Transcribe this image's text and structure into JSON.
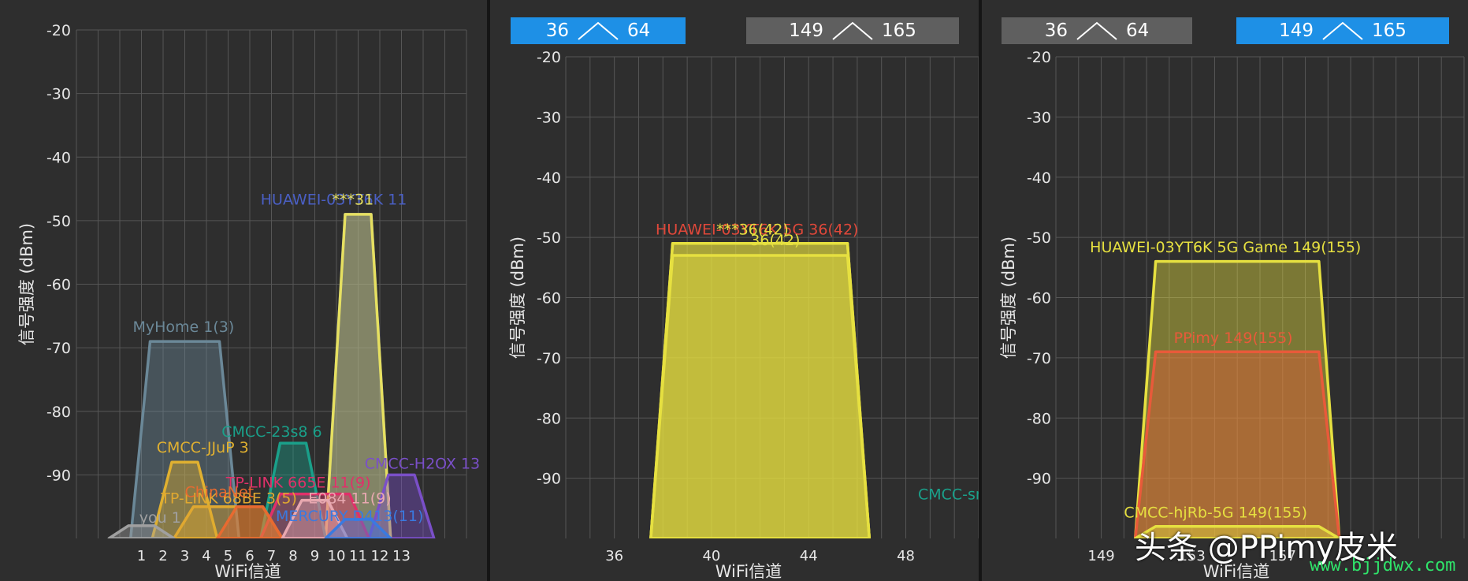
{
  "tabs_panel2": [
    {
      "left_num": "36",
      "right_num": "64",
      "active": true
    },
    {
      "left_num": "149",
      "right_num": "165",
      "active": false
    }
  ],
  "tabs_panel3": [
    {
      "left_num": "36",
      "right_num": "64",
      "active": false
    },
    {
      "left_num": "149",
      "right_num": "165",
      "active": true
    }
  ],
  "watermark": {
    "main": "头条 @PPimy皮米",
    "url": "www.bjjdwx.com"
  },
  "chart_data": [
    {
      "type": "area",
      "ylabel": "信号强度 (dBm)",
      "xlabel": "WiFi信道",
      "ylim": [
        -100,
        -20
      ],
      "xlim": [
        -2,
        16
      ],
      "yticks": [
        -20,
        -30,
        -40,
        -50,
        -60,
        -70,
        -80,
        -90
      ],
      "xticks": [
        1,
        2,
        3,
        4,
        5,
        6,
        7,
        8,
        9,
        10,
        11,
        12,
        13
      ],
      "grid": true,
      "networks": [
        {
          "name": "MyHome 1(3)",
          "channel": 3,
          "width": 3,
          "rssi": -69,
          "color": "#6b8898",
          "label_x": 0.6,
          "label_y": -67.5
        },
        {
          "name": "HUAWEI-03YT6K 11",
          "channel": 11,
          "width": 1,
          "rssi": -49,
          "color": "#4a5fc4",
          "label_x": 6.5,
          "label_y": -47.5
        },
        {
          "name": "***31",
          "channel": 11,
          "width": 1,
          "rssi": -49,
          "color": "#e6e060",
          "label_x": 9.8,
          "label_y": -47.5
        },
        {
          "name": "CMCC-23s8 6",
          "channel": 8,
          "width": 1,
          "rssi": -85,
          "color": "#1aa08a",
          "label_x": 4.7,
          "label_y": -84
        },
        {
          "name": "CMCC-JJuP 3",
          "channel": 3,
          "width": 1,
          "rssi": -88,
          "color": "#e0b030",
          "label_x": 1.7,
          "label_y": -86.5
        },
        {
          "name": "CMCC-H2OX 13",
          "channel": 13,
          "width": 1,
          "rssi": -90,
          "color": "#7a4fc8",
          "label_x": 11.3,
          "label_y": -89
        },
        {
          "name": "TP-LINK 665E 11(9)",
          "channel": 9,
          "width": 3,
          "rssi": -93,
          "color": "#e0306a",
          "label_x": 4.9,
          "label_y": -92
        },
        {
          "name": "TP-LINK 68BE 3(5)",
          "channel": 5,
          "width": 3,
          "rssi": -95,
          "color": "#e0a830",
          "label_x": 1.9,
          "label_y": -94.5
        },
        {
          "name": "ChinaNet",
          "channel": 6,
          "width": 1,
          "rssi": -95,
          "color": "#e86a30",
          "label_x": 3.0,
          "label_y": -93.5
        },
        {
          "name": "E084 11(9)",
          "channel": 9,
          "width": 1,
          "rssi": -94,
          "color": "#e8a8b0",
          "label_x": 8.7,
          "label_y": -94.5
        },
        {
          "name": "MERCURY D413(11)",
          "channel": 11,
          "width": 1,
          "rssi": -97,
          "color": "#3a7ae0",
          "label_x": 7.2,
          "label_y": -97.3
        },
        {
          "name": "you 1",
          "channel": 1,
          "width": 1,
          "rssi": -98,
          "color": "#a0a0a0",
          "label_x": 0.9,
          "label_y": -97.5
        }
      ]
    },
    {
      "type": "area",
      "ylabel": "信号强度 (dBm)",
      "xlabel": "WiFi信道",
      "ylim": [
        -100,
        -20
      ],
      "xlim": [
        34,
        51
      ],
      "yticks": [
        -20,
        -30,
        -40,
        -50,
        -60,
        -70,
        -80,
        -90
      ],
      "xticks": [
        36,
        40,
        44,
        48
      ],
      "grid": true,
      "networks": [
        {
          "name": "HUAWEI-03YT6K 5G 36(42)",
          "channel": 42,
          "width": 7,
          "rssi": -51,
          "color": "#e6e040",
          "label_x": 37.7,
          "label_y": -49.5,
          "label_color": "#e0483a"
        },
        {
          "name": "***36(42)",
          "channel": 42,
          "width": 7,
          "rssi": -51,
          "color": "#e6e040",
          "label_x": 40.2,
          "label_y": -49.5
        },
        {
          "name": "36(42)",
          "channel": 42,
          "width": 7,
          "rssi": -53,
          "color": "#e6e040",
          "label_x": 41.6,
          "label_y": -51.3
        },
        {
          "name": "CMCC-smtf",
          "channel": 54,
          "width": 3,
          "rssi": -95,
          "color": "#1aa08a",
          "label_x": 48.5,
          "label_y": -93.5
        }
      ]
    },
    {
      "type": "area",
      "ylabel": "信号强度 (dBm)",
      "xlabel": "WiFi信道",
      "ylim": [
        -100,
        -20
      ],
      "xlim": [
        147,
        165
      ],
      "yticks": [
        -20,
        -30,
        -40,
        -50,
        -60,
        -70,
        -80,
        -90
      ],
      "xticks": [
        149,
        153,
        157
      ],
      "grid": true,
      "networks": [
        {
          "name": "HUAWEI-03YT6K 5G Game 149(155)",
          "channel": 155,
          "width": 7,
          "rssi": -54,
          "color": "#e6e040",
          "label_x": 148.5,
          "label_y": -52.5
        },
        {
          "name": "PPimy 149(155)",
          "channel": 155,
          "width": 7,
          "rssi": -69,
          "color": "#e85a3a",
          "label_x": 152.2,
          "label_y": -67.5
        },
        {
          "name": "CMCC-hjRb-5G 149(155)",
          "channel": 155,
          "width": 7,
          "rssi": -98,
          "color": "#e6e040",
          "label_x": 150.0,
          "label_y": -96.5
        }
      ]
    }
  ]
}
